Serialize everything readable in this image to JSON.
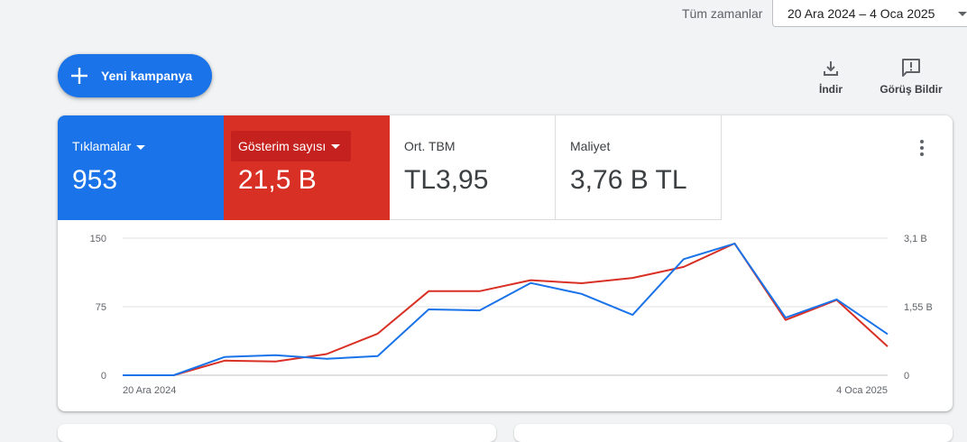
{
  "date_range": {
    "label": "Tüm zamanlar",
    "value": "20 Ara 2024 – 4 Oca 2025"
  },
  "new_campaign": {
    "label": "Yeni kampanya"
  },
  "tools": {
    "download_label": "İndir",
    "feedback_label": "Görüş Bildir"
  },
  "metrics": [
    {
      "name": "Tıklamalar",
      "value": "953",
      "color": "#1a73e8"
    },
    {
      "name": "Gösterim sayısı",
      "value": "21,5 B",
      "color": "#d93025"
    },
    {
      "name": "Ort. TBM",
      "value": "TL3,95"
    },
    {
      "name": "Maliyet",
      "value": "3,76 B TL"
    }
  ],
  "chart_data": {
    "type": "line",
    "x_start_label": "20 Ara 2024",
    "x_end_label": "4 Oca 2025",
    "x": [
      "20 Ara 2024",
      "21 Ara 2024",
      "22 Ara 2024",
      "23 Ara 2024",
      "24 Ara 2024",
      "25 Ara 2024",
      "26 Ara 2024",
      "27 Ara 2024",
      "28 Ara 2024",
      "29 Ara 2024",
      "30 Ara 2024",
      "31 Ara 2024",
      "1 Oca 2025",
      "2 Oca 2025",
      "3 Oca 2025",
      "4 Oca 2025"
    ],
    "y_left": {
      "ticks": [
        "0",
        "75",
        "150"
      ],
      "range": [
        0,
        150
      ]
    },
    "y_right": {
      "ticks": [
        "0",
        "1,55 B",
        "3,1 B"
      ],
      "range": [
        0,
        3100
      ]
    },
    "grid": true,
    "series": [
      {
        "name": "Tıklamalar",
        "axis": "left",
        "color": "#1a73e8",
        "values": [
          0,
          0,
          20,
          22,
          18,
          21,
          72,
          71,
          101,
          89,
          66,
          127,
          144,
          63,
          83,
          45
        ]
      },
      {
        "name": "Gösterim sayısı",
        "axis": "right",
        "color": "#d93025",
        "values": [
          0,
          0,
          330,
          310,
          480,
          940,
          1900,
          1900,
          2150,
          2080,
          2200,
          2450,
          2980,
          1250,
          1700,
          650
        ]
      }
    ]
  }
}
